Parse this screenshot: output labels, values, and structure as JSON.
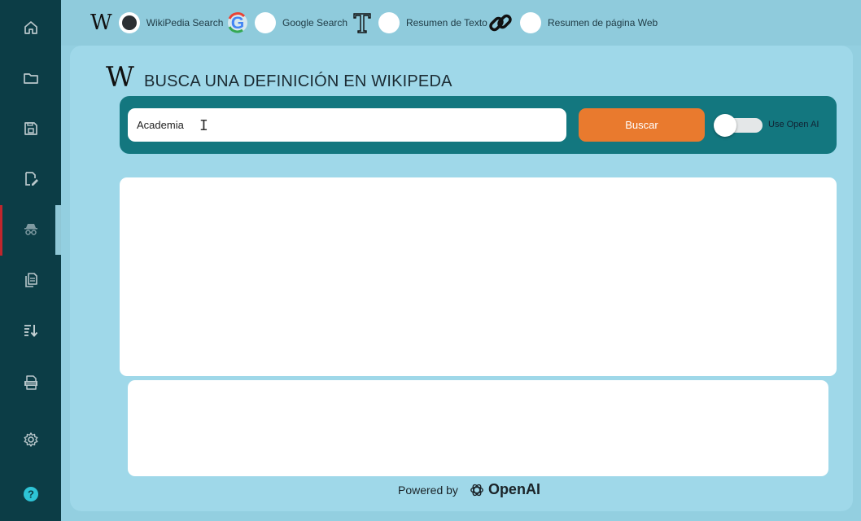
{
  "sidebar": {
    "items": [
      {
        "name": "home-icon"
      },
      {
        "name": "folder-icon"
      },
      {
        "name": "save-icon"
      },
      {
        "name": "edit-document-icon"
      },
      {
        "name": "incognito-icon",
        "active": true
      },
      {
        "name": "documents-icon"
      },
      {
        "name": "sort-descending-icon"
      },
      {
        "name": "docx-icon"
      },
      {
        "name": "settings-icon"
      },
      {
        "name": "help-icon"
      }
    ]
  },
  "topbar": {
    "options": [
      {
        "icon": "wikipedia-icon",
        "label": "WikiPedia Search",
        "selected": true
      },
      {
        "icon": "google-icon",
        "label": "Google Search",
        "selected": false
      },
      {
        "icon": "text-icon",
        "label": "Resumen de Texto",
        "selected": false
      },
      {
        "icon": "link-icon",
        "label": "Resumen de página Web",
        "selected": false
      }
    ]
  },
  "main": {
    "logo_letter": "W",
    "title": "BUSCA UNA DEFINICIÓN EN WIKIPEDA",
    "search": {
      "value": "Academia"
    },
    "search_button": "Buscar",
    "toggle": {
      "label": "Use Open AI",
      "on": false
    },
    "powered_by": "Powered by",
    "openai": "OpenAI"
  },
  "colors": {
    "sidebar": "#0c3d46",
    "accent_orange": "#e97a2e",
    "panel_teal": "#13777f",
    "background": "#9fd8e9"
  }
}
